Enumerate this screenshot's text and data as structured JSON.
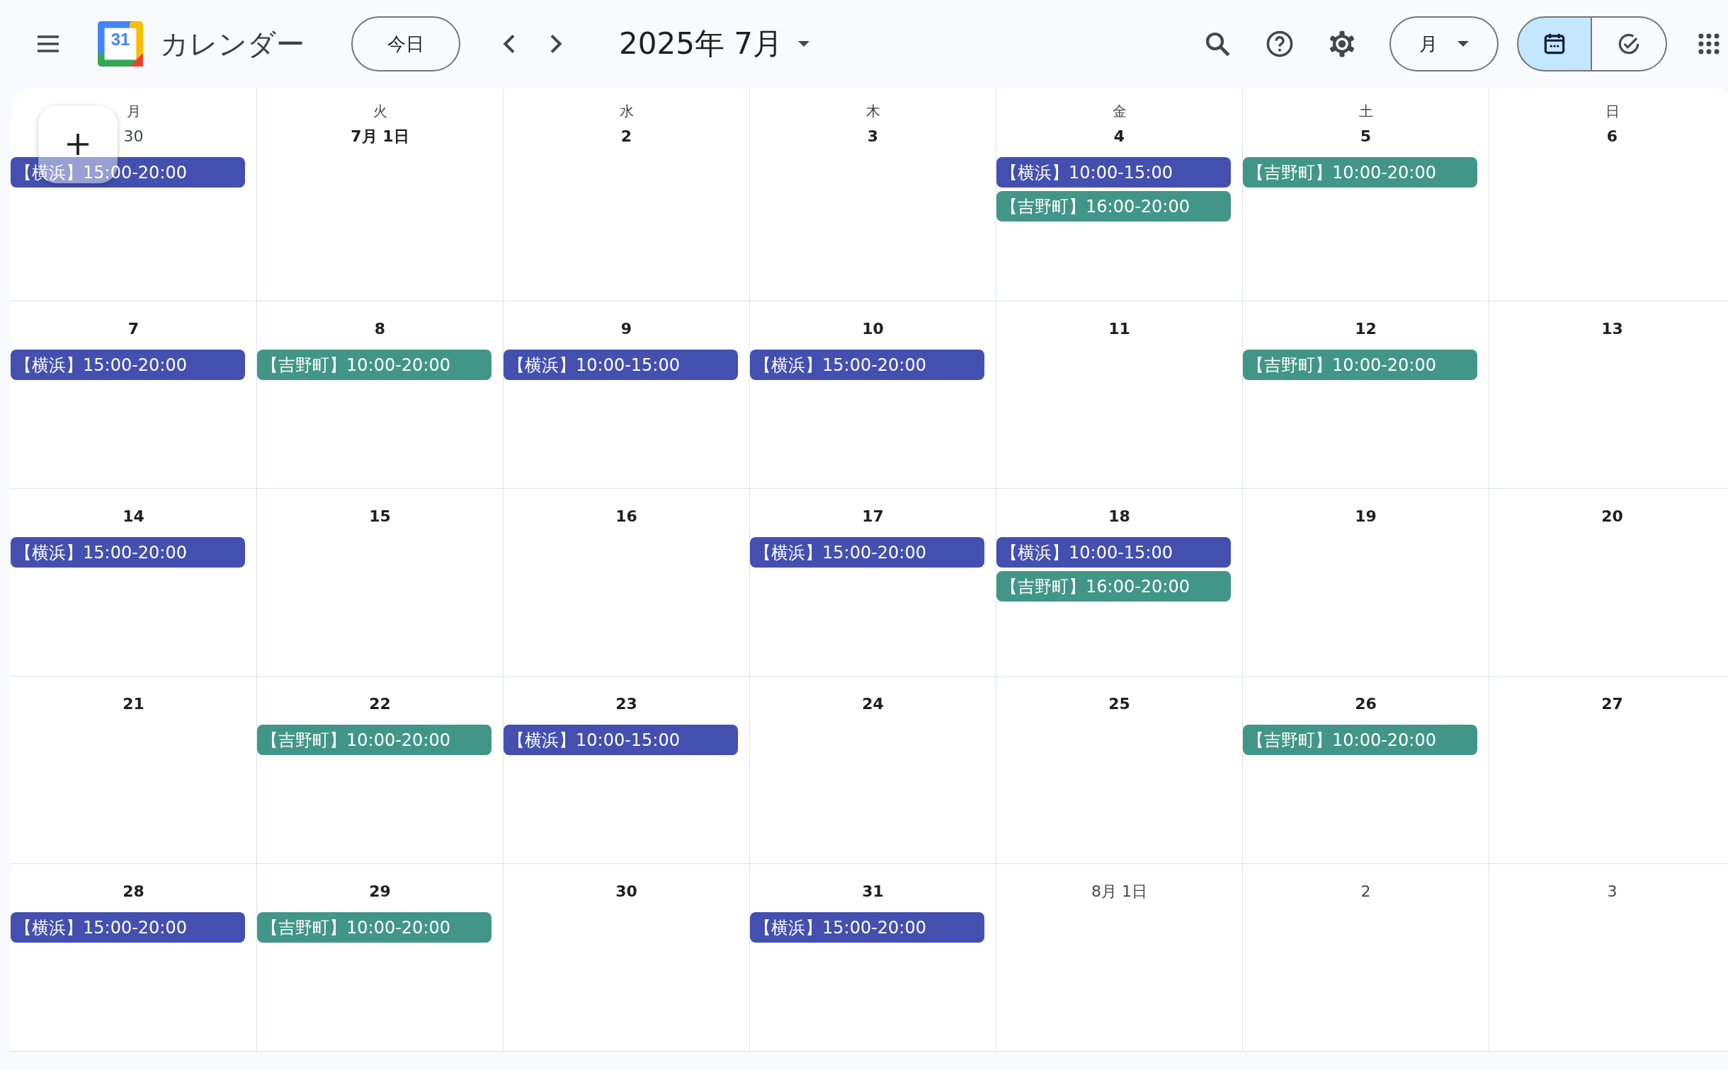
{
  "header": {
    "title": "カレンダー",
    "logo_number": "31",
    "today_button": "今日",
    "month_title": "2025年 7月",
    "view_button": "月",
    "view_toggle": [
      {
        "kind": "calendar",
        "selected": true
      },
      {
        "kind": "tasks",
        "selected": false
      }
    ]
  },
  "weekdays": [
    "月",
    "火",
    "水",
    "木",
    "金",
    "土",
    "日"
  ],
  "weeks": [
    [
      {
        "date": "30",
        "in_month": false,
        "events": [
          {
            "text": "【横浜】15:00-20:00",
            "color": "#4350af"
          }
        ]
      },
      {
        "date": "7月 1日",
        "in_month": true
      },
      {
        "date": "2",
        "in_month": true
      },
      {
        "date": "3",
        "in_month": true
      },
      {
        "date": "4",
        "in_month": true,
        "events": [
          {
            "text": "【横浜】10:00-15:00",
            "color": "#4350af"
          },
          {
            "text": "【吉野町】16:00-20:00",
            "color": "#419687"
          }
        ]
      },
      {
        "date": "5",
        "in_month": true,
        "events": [
          {
            "text": "【吉野町】10:00-20:00",
            "color": "#419687"
          }
        ]
      },
      {
        "date": "6",
        "in_month": true
      }
    ],
    [
      {
        "date": "7",
        "in_month": true,
        "events": [
          {
            "text": "【横浜】15:00-20:00",
            "color": "#4350af"
          }
        ]
      },
      {
        "date": "8",
        "in_month": true,
        "events": [
          {
            "text": "【吉野町】10:00-20:00",
            "color": "#419687"
          }
        ]
      },
      {
        "date": "9",
        "in_month": true,
        "events": [
          {
            "text": "【横浜】10:00-15:00",
            "color": "#4350af"
          }
        ]
      },
      {
        "date": "10",
        "in_month": true,
        "events": [
          {
            "text": "【横浜】15:00-20:00",
            "color": "#4350af"
          }
        ]
      },
      {
        "date": "11",
        "in_month": true
      },
      {
        "date": "12",
        "in_month": true,
        "events": [
          {
            "text": "【吉野町】10:00-20:00",
            "color": "#419687"
          }
        ]
      },
      {
        "date": "13",
        "in_month": true
      }
    ],
    [
      {
        "date": "14",
        "in_month": true,
        "events": [
          {
            "text": "【横浜】15:00-20:00",
            "color": "#4350af"
          }
        ]
      },
      {
        "date": "15",
        "in_month": true
      },
      {
        "date": "16",
        "in_month": true
      },
      {
        "date": "17",
        "in_month": true,
        "events": [
          {
            "text": "【横浜】15:00-20:00",
            "color": "#4350af"
          }
        ]
      },
      {
        "date": "18",
        "in_month": true,
        "events": [
          {
            "text": "【横浜】10:00-15:00",
            "color": "#4350af"
          },
          {
            "text": "【吉野町】16:00-20:00",
            "color": "#419687"
          }
        ]
      },
      {
        "date": "19",
        "in_month": true
      },
      {
        "date": "20",
        "in_month": true
      }
    ],
    [
      {
        "date": "21",
        "in_month": true
      },
      {
        "date": "22",
        "in_month": true,
        "events": [
          {
            "text": "【吉野町】10:00-20:00",
            "color": "#419687"
          }
        ]
      },
      {
        "date": "23",
        "in_month": true,
        "events": [
          {
            "text": "【横浜】10:00-15:00",
            "color": "#4350af"
          }
        ]
      },
      {
        "date": "24",
        "in_month": true
      },
      {
        "date": "25",
        "in_month": true
      },
      {
        "date": "26",
        "in_month": true,
        "events": [
          {
            "text": "【吉野町】10:00-20:00",
            "color": "#419687"
          }
        ]
      },
      {
        "date": "27",
        "in_month": true
      }
    ],
    [
      {
        "date": "28",
        "in_month": true,
        "events": [
          {
            "text": "【横浜】15:00-20:00",
            "color": "#4350af"
          }
        ]
      },
      {
        "date": "29",
        "in_month": true,
        "events": [
          {
            "text": "【吉野町】10:00-20:00",
            "color": "#419687"
          }
        ]
      },
      {
        "date": "30",
        "in_month": true
      },
      {
        "date": "31",
        "in_month": true,
        "events": [
          {
            "text": "【横浜】15:00-20:00",
            "color": "#4350af"
          }
        ]
      },
      {
        "date": "8月 1日",
        "in_month": false
      },
      {
        "date": "2",
        "in_month": false
      },
      {
        "date": "3",
        "in_month": false
      }
    ]
  ]
}
